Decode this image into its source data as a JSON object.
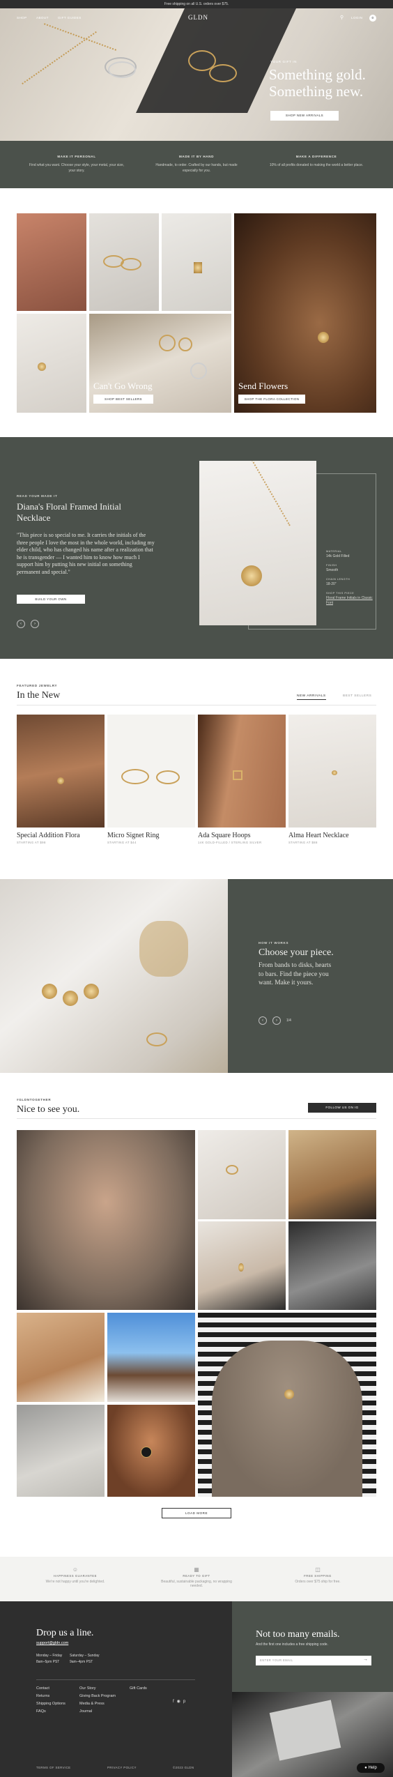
{
  "topbar": {
    "text": "Free shipping on all U.S. orders over $75."
  },
  "nav": {
    "shop": "SHOP",
    "about": "ABOUT",
    "gift_guides": "GIFT GUIDES",
    "logo": "GLDN",
    "login": "LOGIN",
    "cart_count": "0"
  },
  "hero": {
    "eyebrow": "YOUR GIFT IN",
    "title_1": "Something gold.",
    "title_2": "Something new.",
    "cta": "SHOP NEW ARRIVALS"
  },
  "values": [
    {
      "title": "MAKE IT PERSONAL",
      "text": "Find what you want. Choose your style, your metal, your size, your story."
    },
    {
      "title": "MADE IT BY HAND",
      "text": "Handmade, to order. Crafted by our hands, but made especially for you."
    },
    {
      "title": "MAKE A DIFFERENCE",
      "text": "10% of all profits donated to making the world a better place."
    }
  ],
  "collage": {
    "cant_go_wrong": "Can't Go Wrong",
    "shop_best": "SHOP BEST SELLERS",
    "send_flowers": "Send Flowers",
    "shop_floral": "SHOP THE FLORA COLLECTION"
  },
  "story": {
    "eyebrow": "READ YOUR MADE IT",
    "title": "Diana's Floral Framed Initial Necklace",
    "quote": "\"This piece is so special to me. It carries the initials of the three people I love the most in the whole world, including my elder child, who has changed his name after a realization that he is transgender — I wanted him to know how much I support him by putting his new initial on something permanent and special.\"",
    "cta": "BUILD YOUR OWN",
    "specs": [
      {
        "label": "MATERIAL",
        "value": "14k Gold Filled"
      },
      {
        "label": "FINISH",
        "value": "Smooth"
      },
      {
        "label": "CHAIN LENGTH",
        "value": "18-20\""
      },
      {
        "label": "SHOP THIS PIECE",
        "value": "Floral Frame Initials in Classic Font"
      }
    ]
  },
  "featured": {
    "eyebrow": "FEATURED JEWELRY",
    "title": "In the New",
    "tab_new": "NEW ARRIVALS",
    "tab_best": "BEST SELLERS",
    "products": [
      {
        "name": "Special Addition Flora",
        "sub": "STARTING AT $98"
      },
      {
        "name": "Micro Signet Ring",
        "sub": "STARTING AT $44"
      },
      {
        "name": "Ada Square Hoops",
        "sub": "14K GOLD-FILLED / STERLING SILVER"
      },
      {
        "name": "Alma Heart Necklace",
        "sub": "STARTING AT $88"
      }
    ]
  },
  "how": {
    "eyebrow": "HOW IT WORKS",
    "title": "Choose your piece.",
    "text": "From bands to disks, hearts to bars. Find the piece you want. Make it yours.",
    "counter": "1/4"
  },
  "social": {
    "eyebrow": "#GLDNTOGETHER",
    "title": "Nice to see you.",
    "follow": "FOLLOW US ON IG",
    "load_more": "LOAD MORE"
  },
  "guarantees": [
    {
      "title": "HAPPINESS GUARANTEE",
      "text": "We're not happy until you're delighted."
    },
    {
      "title": "READY TO GIFT",
      "text": "Beautiful, sustainable packaging, no wrapping needed."
    },
    {
      "title": "FREE SHIPPING",
      "text": "Orders over $75 ship for free."
    }
  ],
  "footer": {
    "title": "Drop us a line.",
    "email": "support@gldn.com",
    "hours_1_label": "Monday – Friday",
    "hours_1": "8am–5pm PST",
    "hours_2_label": "Saturday – Sunday",
    "hours_2": "9am–4pm PST",
    "links_1": [
      "Contact",
      "Returns",
      "Shipping Options",
      "FAQs"
    ],
    "links_2": [
      "Our Story",
      "Giving Back Program",
      "Media & Press",
      "Journal"
    ],
    "links_3": [
      "Gift Cards"
    ],
    "newsletter_title": "Not too many emails.",
    "newsletter_text": "And the first one includes a free shipping code.",
    "newsletter_placeholder": "ENTER YOUR EMAIL",
    "terms": "TERMS OF SERVICE",
    "privacy": "PRIVACY POLICY",
    "copyright": "©2023 GLDN",
    "help": "Help"
  }
}
